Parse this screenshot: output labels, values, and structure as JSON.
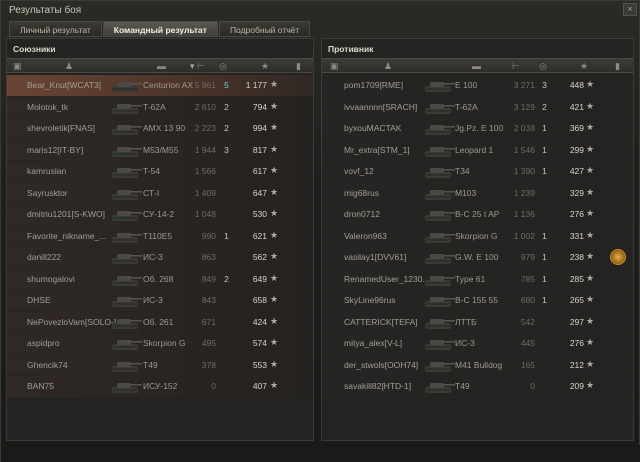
{
  "window": {
    "title": "Результаты боя",
    "close_glyph": "×"
  },
  "tabs": [
    {
      "label": "Личный результат",
      "active": false
    },
    {
      "label": "Командный результат",
      "active": true
    },
    {
      "label": "Подробный отчёт",
      "active": false
    }
  ],
  "allies": {
    "title": "Союзники",
    "columns": [
      "squad-icon",
      "player-icon",
      "tank-icon",
      "damage-icon",
      "kills-icon",
      "star-icon",
      "medal-icon"
    ],
    "rows": [
      {
        "name": "Bear_Knut[WCAT3]",
        "tank": "Centurion AX",
        "damage": "5 961",
        "kills": "5",
        "xp": "1 177",
        "highlight": true
      },
      {
        "name": "Molotok_tk",
        "tank": "T-62A",
        "damage": "2 810",
        "kills": "2",
        "xp": "794"
      },
      {
        "name": "shevroletik[FNAS]",
        "tank": "AMX 13 90",
        "damage": "2 223",
        "kills": "2",
        "xp": "994"
      },
      {
        "name": "maris12[IT-BY]",
        "tank": "M53/M55",
        "damage": "1 944",
        "kills": "3",
        "xp": "817"
      },
      {
        "name": "kamruslan",
        "tank": "T-54",
        "damage": "1 566",
        "kills": "",
        "xp": "617"
      },
      {
        "name": "Sayrusktor",
        "tank": "СТ-I",
        "damage": "1 409",
        "kills": "",
        "xp": "647"
      },
      {
        "name": "dmitriu1201[S-KWO]",
        "tank": "СУ-14-2",
        "damage": "1 048",
        "kills": "",
        "xp": "530"
      },
      {
        "name": "Favorite_nikname_...",
        "tank": "T110E5",
        "damage": "990",
        "kills": "1",
        "xp": "621"
      },
      {
        "name": "danill222",
        "tank": "ИС-3",
        "damage": "863",
        "kills": "",
        "xp": "562"
      },
      {
        "name": "shumogalovi",
        "tank": "Об. 268",
        "damage": "849",
        "kills": "2",
        "xp": "649"
      },
      {
        "name": "DHSE",
        "tank": "ИС-3",
        "damage": "843",
        "kills": "",
        "xp": "658"
      },
      {
        "name": "NePovezloVam[SOLO-]",
        "tank": "Об. 261",
        "damage": "671",
        "kills": "",
        "xp": "424"
      },
      {
        "name": "aspidpro",
        "tank": "Skorpion G",
        "damage": "495",
        "kills": "",
        "xp": "574"
      },
      {
        "name": "Ghencik74",
        "tank": "T49",
        "damage": "378",
        "kills": "",
        "xp": "553"
      },
      {
        "name": "BAN75",
        "tank": "ИСУ-152",
        "damage": "0",
        "kills": "",
        "xp": "407"
      }
    ]
  },
  "enemies": {
    "title": "Противник",
    "rows": [
      {
        "name": "pom1709[RME]",
        "tank": "E 100",
        "damage": "3 271",
        "kills": "3",
        "xp": "448"
      },
      {
        "name": "ivvaannnn[SRACH]",
        "tank": "T-62A",
        "damage": "3 129",
        "kills": "2",
        "xp": "421"
      },
      {
        "name": "byxouMACTAK",
        "tank": "Jg.Pz. E 100",
        "damage": "2 038",
        "kills": "1",
        "xp": "369"
      },
      {
        "name": "Mr_extra[STM_1]",
        "tank": "Leopard 1",
        "damage": "1 546",
        "kills": "1",
        "xp": "299"
      },
      {
        "name": "vovf_12",
        "tank": "T34",
        "damage": "1 390",
        "kills": "1",
        "xp": "427"
      },
      {
        "name": "mig68rus",
        "tank": "M103",
        "damage": "1 239",
        "kills": "",
        "xp": "329"
      },
      {
        "name": "dron0712",
        "tank": "B-C 25 t AP",
        "damage": "1 136",
        "kills": "",
        "xp": "276"
      },
      {
        "name": "Valeron963",
        "tank": "Skorpion G",
        "damage": "1 002",
        "kills": "1",
        "xp": "331"
      },
      {
        "name": "vasilay1[DVV61]",
        "tank": "G.W. E 100",
        "damage": "979",
        "kills": "1",
        "xp": "238",
        "medal": true
      },
      {
        "name": "RenamedUser_1230...",
        "tank": "Type 61",
        "damage": "785",
        "kills": "1",
        "xp": "285"
      },
      {
        "name": "SkyLine96rus",
        "tank": "B-C 155 55",
        "damage": "680",
        "kills": "1",
        "xp": "265"
      },
      {
        "name": "CATTERICK[TEFA]",
        "tank": "ЛТТБ",
        "damage": "542",
        "kills": "",
        "xp": "297"
      },
      {
        "name": "mitya_alex[V-L]",
        "tank": "ИС-3",
        "damage": "445",
        "kills": "",
        "xp": "276"
      },
      {
        "name": "der_stwols[OOH74]",
        "tank": "M41 Bulldog",
        "damage": "165",
        "kills": "",
        "xp": "212"
      },
      {
        "name": "savakill82[HTD-1]",
        "tank": "T49",
        "damage": "0",
        "kills": "",
        "xp": "209"
      }
    ]
  },
  "star_glyph": "★"
}
